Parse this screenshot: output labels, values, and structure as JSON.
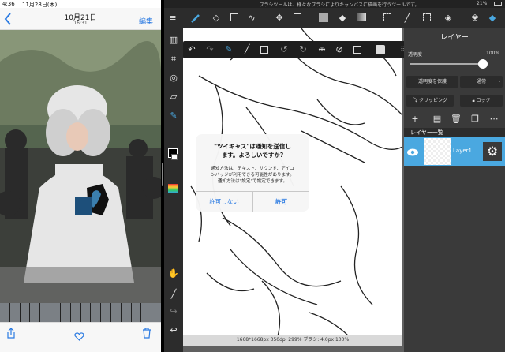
{
  "ios_status": {
    "time": "4:36",
    "date": "11月28日(木)",
    "battery": "21%"
  },
  "photos": {
    "date": "10月21日",
    "time": "16:31",
    "edit_label": "編集"
  },
  "medibang": {
    "title": "ブラシツールは、様々なブラシによりキャンバスに描画を行うツールです。",
    "canvas_info": "1668*1668px 350dpi 299% ブラシ: 4.0px 100%",
    "panel": {
      "title": "レイヤー",
      "opacity_label": "透明度",
      "opacity_value": "100%",
      "opacity": 1.0,
      "protect_alpha": "透明度を保護",
      "blend_mode": "通常",
      "clipping": "クリッピング",
      "lock": "ロック",
      "layer_list_title": "レイヤー一覧",
      "layers": [
        {
          "name": "Layer1"
        }
      ]
    },
    "accent": "#4aa8e0"
  },
  "dialog": {
    "title_line1": "\"ツイキャス\"は通知を送信し",
    "title_line2": "ます。よろしいですか?",
    "msg_line1": "通知方法は、テキスト、サウンド、アイコ",
    "msg_line2": "ンバッジが利用できる可能性があります。",
    "msg_line3": "通知方法は\"設定\"で設定できます。",
    "deny_label": "許可しない",
    "allow_label": "許可",
    "button_color": "#2a7ae2"
  }
}
